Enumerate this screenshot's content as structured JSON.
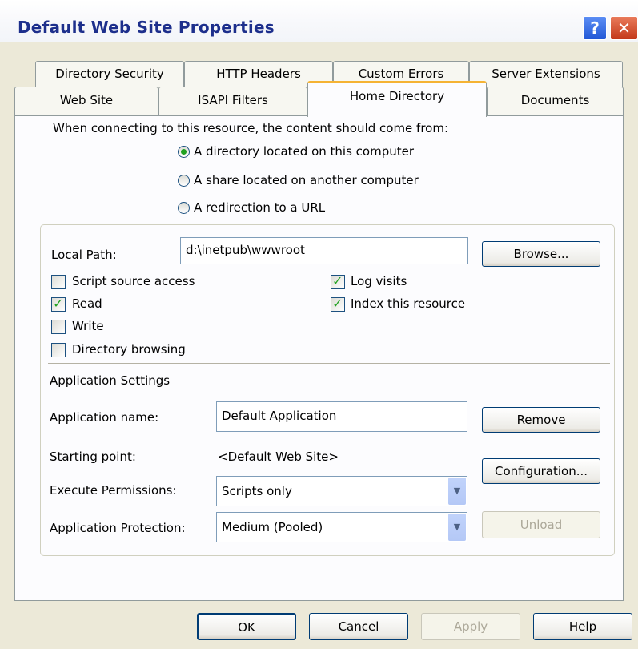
{
  "window": {
    "title": "Default Web Site Properties",
    "help_glyph": "?",
    "close_glyph": "✕"
  },
  "tabs_row1": [
    "Directory Security",
    "HTTP Headers",
    "Custom Errors",
    "Server Extensions"
  ],
  "tabs_row2": [
    "Web Site",
    "ISAPI Filters",
    "Home Directory",
    "Documents"
  ],
  "active_tab": "Home Directory",
  "source": {
    "prompt": "When connecting to this resource, the content should come from:",
    "options": [
      "A directory located on this computer",
      "A share located on another computer",
      "A redirection to a URL"
    ],
    "selected_index": 0
  },
  "local_path": {
    "label": "Local Path:",
    "value": "d:\\inetpub\\wwwroot",
    "browse_label": "Browse..."
  },
  "permissions": [
    {
      "label": "Script source access",
      "checked": false
    },
    {
      "label": "Read",
      "checked": true
    },
    {
      "label": "Write",
      "checked": false
    },
    {
      "label": "Directory browsing",
      "checked": false
    },
    {
      "label": "Log visits",
      "checked": true
    },
    {
      "label": "Index this resource",
      "checked": true
    }
  ],
  "app_settings": {
    "heading": "Application Settings",
    "name_label": "Application name:",
    "name_value": "Default Application",
    "remove_label": "Remove",
    "starting_label": "Starting point:",
    "starting_value": "<Default Web Site>",
    "config_label": "Configuration...",
    "exec_label": "Execute Permissions:",
    "exec_value": "Scripts only",
    "protection_label": "Application Protection:",
    "protection_value": "Medium (Pooled)",
    "unload_label": "Unload"
  },
  "footer": {
    "ok": "OK",
    "cancel": "Cancel",
    "apply": "Apply",
    "help": "Help"
  },
  "dropdown_arrow": "▼"
}
